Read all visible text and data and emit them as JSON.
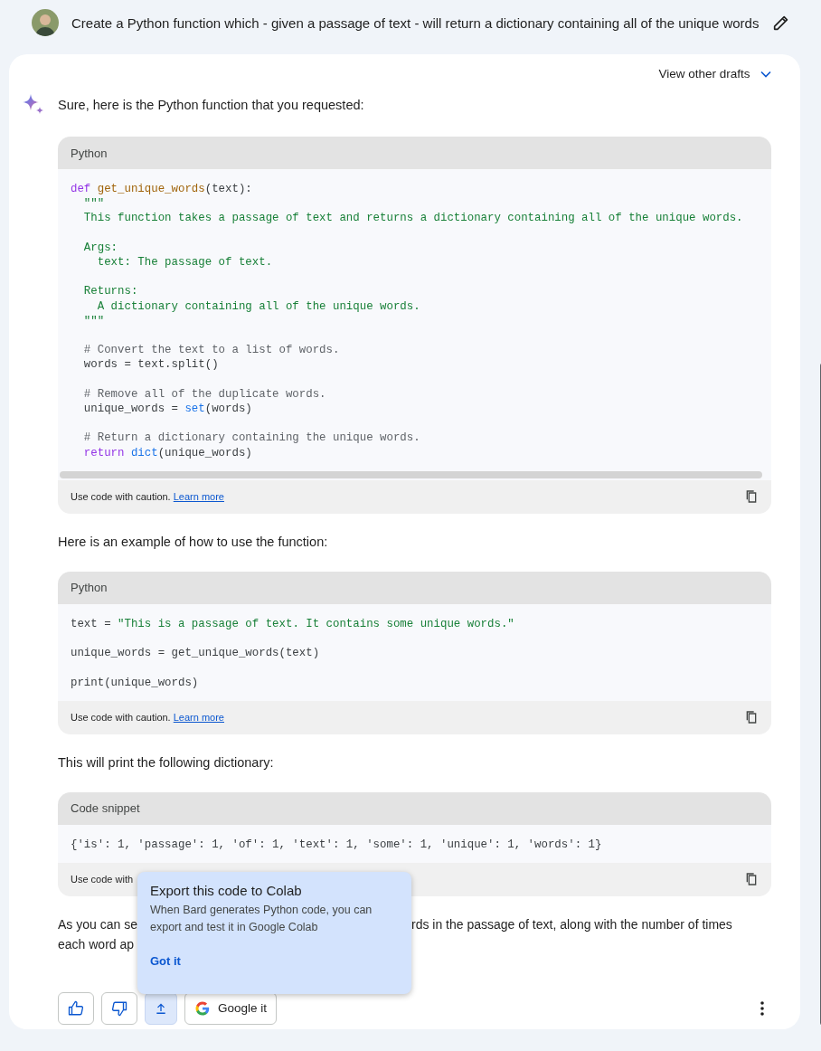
{
  "prompt": {
    "text": "Create a Python function which - given a passage of text - will return a dictionary containing all of the unique words"
  },
  "drafts": {
    "label": "View other drafts"
  },
  "blocks": [
    {
      "kind": "paragraph",
      "text": "Sure, here is the Python function that you requested:"
    },
    {
      "kind": "code",
      "language": "Python",
      "h_scroll": true,
      "caution": "Use code with caution.",
      "link": "Learn more",
      "lines": [
        {
          "kind": "code",
          "tokens": [
            {
              "kind": "kw",
              "text": "def "
            },
            {
              "kind": "fn",
              "text": "get_unique_words"
            },
            {
              "kind": "txt",
              "text": "(text):"
            }
          ]
        },
        {
          "kind": "code",
          "tokens": [
            {
              "kind": "str",
              "text": "  \"\"\""
            }
          ]
        },
        {
          "kind": "code",
          "tokens": [
            {
              "kind": "str",
              "text": "  This function takes a passage of text and returns a dictionary containing all of the unique words."
            }
          ]
        },
        {
          "kind": "blank"
        },
        {
          "kind": "code",
          "tokens": [
            {
              "kind": "str",
              "text": "  Args:"
            }
          ]
        },
        {
          "kind": "code",
          "tokens": [
            {
              "kind": "str",
              "text": "    text: The passage of text."
            }
          ]
        },
        {
          "kind": "blank"
        },
        {
          "kind": "code",
          "tokens": [
            {
              "kind": "str",
              "text": "  Returns:"
            }
          ]
        },
        {
          "kind": "code",
          "tokens": [
            {
              "kind": "str",
              "text": "    A dictionary containing all of the unique words."
            }
          ]
        },
        {
          "kind": "code",
          "tokens": [
            {
              "kind": "str",
              "text": "  \"\"\""
            }
          ]
        },
        {
          "kind": "blank"
        },
        {
          "kind": "code",
          "tokens": [
            {
              "kind": "com",
              "text": "  # Convert the text to a list of words."
            }
          ]
        },
        {
          "kind": "code",
          "tokens": [
            {
              "kind": "txt",
              "text": "  words = text.split()"
            }
          ]
        },
        {
          "kind": "blank"
        },
        {
          "kind": "code",
          "tokens": [
            {
              "kind": "com",
              "text": "  # Remove all of the duplicate words."
            }
          ]
        },
        {
          "kind": "code",
          "tokens": [
            {
              "kind": "txt",
              "text": "  unique_words = "
            },
            {
              "kind": "bi",
              "text": "set"
            },
            {
              "kind": "txt",
              "text": "(words)"
            }
          ]
        },
        {
          "kind": "blank"
        },
        {
          "kind": "code",
          "tokens": [
            {
              "kind": "com",
              "text": "  # Return a dictionary containing the unique words."
            }
          ]
        },
        {
          "kind": "code",
          "tokens": [
            {
              "kind": "kw",
              "text": "  return "
            },
            {
              "kind": "bi",
              "text": "dict"
            },
            {
              "kind": "txt",
              "text": "(unique_words)"
            }
          ]
        }
      ]
    },
    {
      "kind": "paragraph",
      "text": "Here is an example of how to use the function:"
    },
    {
      "kind": "code",
      "language": "Python",
      "h_scroll": false,
      "caution": "Use code with caution.",
      "link": "Learn more",
      "lines": [
        {
          "kind": "code",
          "tokens": [
            {
              "kind": "txt",
              "text": "text = "
            },
            {
              "kind": "str",
              "text": "\"This is a passage of text. It contains some unique words.\""
            }
          ]
        },
        {
          "kind": "blank"
        },
        {
          "kind": "code",
          "tokens": [
            {
              "kind": "txt",
              "text": "unique_words = get_unique_words(text)"
            }
          ]
        },
        {
          "kind": "blank"
        },
        {
          "kind": "code",
          "tokens": [
            {
              "kind": "txt",
              "text": "print(unique_words)"
            }
          ]
        }
      ]
    },
    {
      "kind": "paragraph",
      "text": "This will print the following dictionary:"
    },
    {
      "kind": "code",
      "language": "Code snippet",
      "h_scroll": false,
      "caution": "Use code with",
      "lines": [
        {
          "kind": "code",
          "tokens": [
            {
              "kind": "txt",
              "text": "{'is': 1, 'passage': 1, 'of': 1, 'text': 1, 'some': 1, 'unique': 1, 'words': 1}"
            }
          ]
        }
      ]
    },
    {
      "kind": "covered_paragraph",
      "lines": [
        [
          "As you can se",
          "rds in the passage of text, along with the number of times"
        ],
        [
          "each word ap"
        ]
      ]
    }
  ],
  "tooltip": {
    "title": "Export this code to Colab",
    "text": "When Bard generates Python code, you can export and test it in Google Colab",
    "action": "Got it"
  },
  "actions": [
    {
      "kind": "thumbs_up",
      "selected": false
    },
    {
      "kind": "thumbs_down",
      "selected": false
    },
    {
      "kind": "export",
      "selected": true
    },
    {
      "kind": "google",
      "label": "Google it",
      "selected": false
    }
  ]
}
